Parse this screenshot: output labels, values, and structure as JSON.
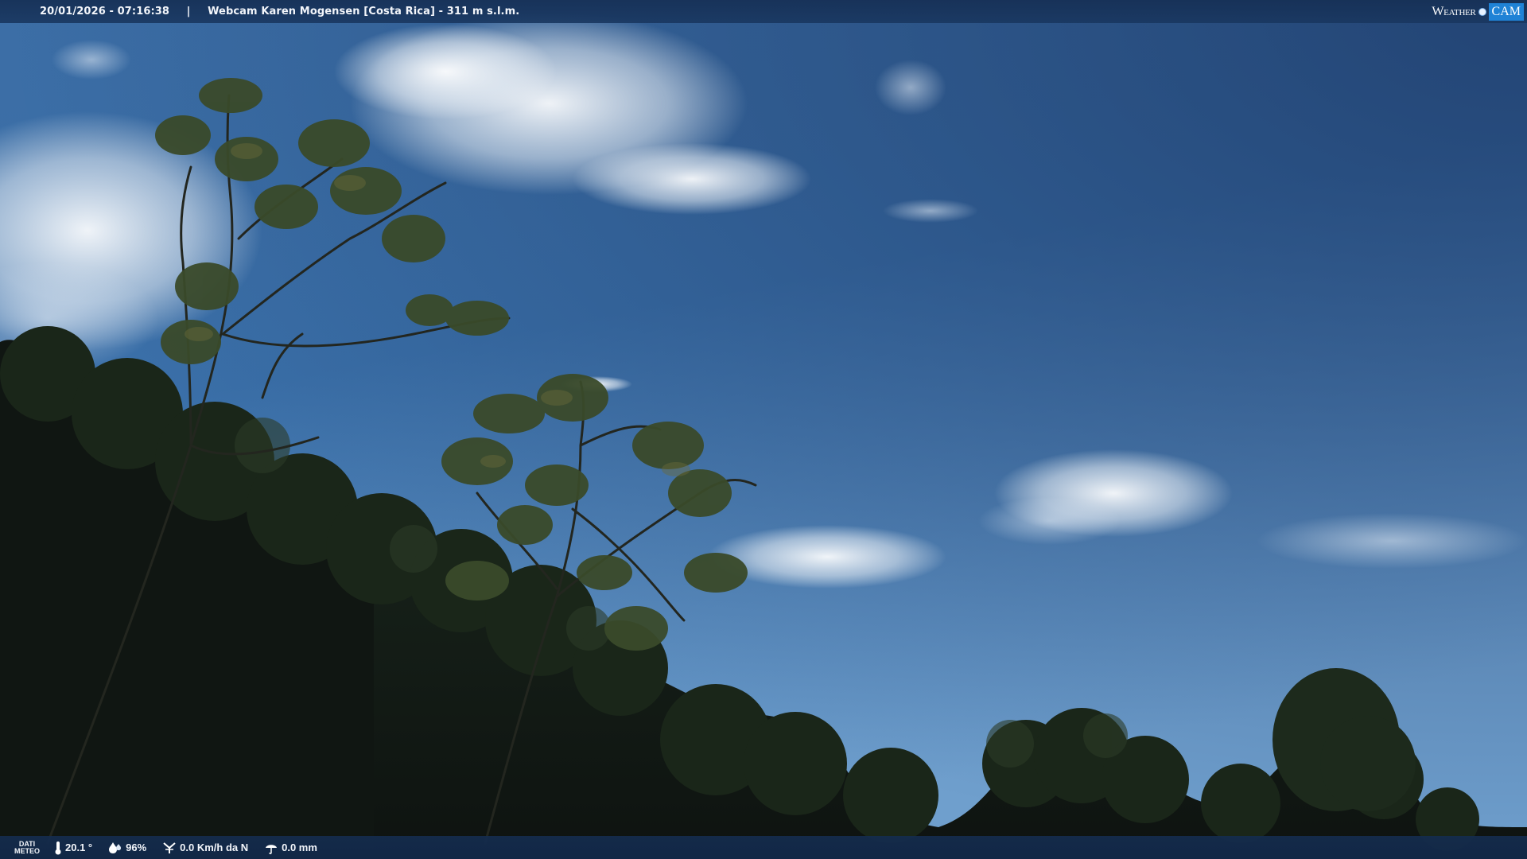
{
  "top_bar": {
    "datetime": "20/01/2026 - 07:16:38",
    "separator": "|",
    "title": "Webcam Karen Mogensen [Costa Rica]  - 311 m s.l.m."
  },
  "brand": {
    "part_a": "Weather",
    "part_b": "CAM"
  },
  "weather": {
    "label_line1": "DATI",
    "label_line2": "METEO",
    "temperature": "20.1 °",
    "humidity": "96%",
    "wind": "0.0 Km/h da N",
    "rain": "0.0 mm",
    "icons": [
      "thermometer-icon",
      "humidity-drop-icon",
      "wind-icon",
      "rain-icon"
    ]
  },
  "colors": {
    "sky_top": "#234a7a",
    "sky_mid": "#3d74ad",
    "sky_horizon": "#6a9ccc",
    "foliage_dark": "#121a16",
    "bar_bg": "#17305a",
    "brand_blue": "#1f82d6"
  }
}
